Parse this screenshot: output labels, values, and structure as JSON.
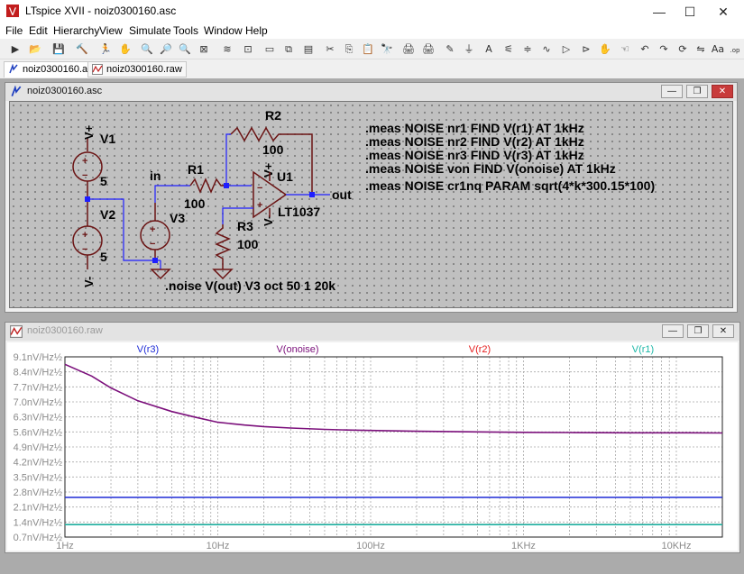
{
  "window": {
    "title": "LTspice XVII - noiz0300160.asc",
    "icon": "ltspice-logo-icon"
  },
  "menu": [
    "File",
    "Edit",
    "Hierarchy",
    "View",
    "Simulate",
    "Tools",
    "Window",
    "Help"
  ],
  "toolbar_icons": [
    "new-schematic-icon",
    "open-icon",
    "save-icon",
    "control-panel-icon",
    "run-icon",
    "halt-icon",
    "zoom-in-icon",
    "pan-icon",
    "zoom-out-icon",
    "zoom-fit-icon",
    "waveform-icon",
    "spice-directive-icon",
    "tile-horizontal-icon",
    "cascade-icon",
    "tile-vertical-icon",
    "cut-icon",
    "copy-icon",
    "paste-icon",
    "find-icon",
    "print-icon",
    "print-setup-icon",
    "draw-wire-icon",
    "ground-icon",
    "label-net-icon",
    "resistor-icon",
    "capacitor-icon",
    "inductor-icon",
    "diode-icon",
    "component-icon",
    "move-icon",
    "drag-icon",
    "undo-icon",
    "redo-icon",
    "rotate-icon",
    "mirror-icon",
    "text-icon",
    "spice-op-icon"
  ],
  "tabs": [
    {
      "label": "noiz0300160.asc",
      "icon": "schematic-icon",
      "active": true
    },
    {
      "label": "noiz0300160.raw",
      "icon": "waveform-icon",
      "active": false
    }
  ],
  "schematic_window": {
    "title": "noiz0300160.asc"
  },
  "plot_window": {
    "title": "noiz0300160.raw"
  },
  "schematic": {
    "v1": {
      "name": "V1",
      "value": "5",
      "plus": "V+"
    },
    "v2": {
      "name": "V2",
      "value": "5",
      "minus": "V-"
    },
    "v3": {
      "name": "V3"
    },
    "r1": {
      "name": "R1",
      "value": "100"
    },
    "r2": {
      "name": "R2",
      "value": "100"
    },
    "r3": {
      "name": "R3",
      "value": "100"
    },
    "u1": {
      "name": "U1",
      "model": "LT1037",
      "plus": "V+",
      "minus": "V-"
    },
    "net_in": "in",
    "net_out": "out",
    "directives": [
      ".meas NOISE nr1 FIND V(r1) AT 1kHz",
      ".meas NOISE nr2 FIND V(r2) AT 1kHz",
      ".meas NOISE nr3 FIND V(r3) AT 1kHz",
      ".meas NOISE von FIND V(onoise) AT 1kHz",
      ".meas NOISE cr1nq PARAM sqrt(4*k*300.15*100)"
    ],
    "noise_directive": ".noise V(out) V3 oct 50 1 20k"
  },
  "colors": {
    "wire": "#1f1fff",
    "component": "#6b1414",
    "trace_onoise": "#7b0f7b",
    "trace_r3": "#1e2bd6",
    "trace_r1": "#1db8a8",
    "trace_r2": "#e51c1c"
  },
  "chart_data": {
    "type": "line",
    "xscale": "log",
    "xlim": [
      1,
      20000
    ],
    "ylim": [
      0.7,
      9.1
    ],
    "xticks": [
      "1Hz",
      "10Hz",
      "100Hz",
      "1KHz",
      "10KHz"
    ],
    "yticks": [
      "9.1nV/Hz½",
      "8.4nV/Hz½",
      "7.7nV/Hz½",
      "7.0nV/Hz½",
      "6.3nV/Hz½",
      "5.6nV/Hz½",
      "4.9nV/Hz½",
      "4.2nV/Hz½",
      "3.5nV/Hz½",
      "2.8nV/Hz½",
      "2.1nV/Hz½",
      "1.4nV/Hz½",
      "0.7nV/Hz½"
    ],
    "grid": true,
    "series": [
      {
        "name": "V(r3)",
        "color": "#1e2bd6",
        "x": [
          1,
          20000
        ],
        "y": [
          2.55,
          2.55
        ]
      },
      {
        "name": "V(onoise)",
        "color": "#7b0f7b",
        "x": [
          1,
          1.5,
          2,
          3,
          5,
          7,
          10,
          15,
          20,
          30,
          50,
          70,
          100,
          200,
          500,
          1000,
          2000,
          5000,
          10000,
          20000
        ],
        "y": [
          8.75,
          8.2,
          7.65,
          7.05,
          6.55,
          6.3,
          6.05,
          5.92,
          5.85,
          5.78,
          5.72,
          5.69,
          5.67,
          5.63,
          5.6,
          5.58,
          5.57,
          5.56,
          5.56,
          5.55
        ]
      },
      {
        "name": "V(r2)",
        "color": "#e51c1c",
        "x": [
          1,
          20000
        ],
        "y": [
          1.28,
          1.28
        ]
      },
      {
        "name": "V(r1)",
        "color": "#1db8a8",
        "x": [
          1,
          20000
        ],
        "y": [
          1.28,
          1.28
        ]
      }
    ]
  }
}
